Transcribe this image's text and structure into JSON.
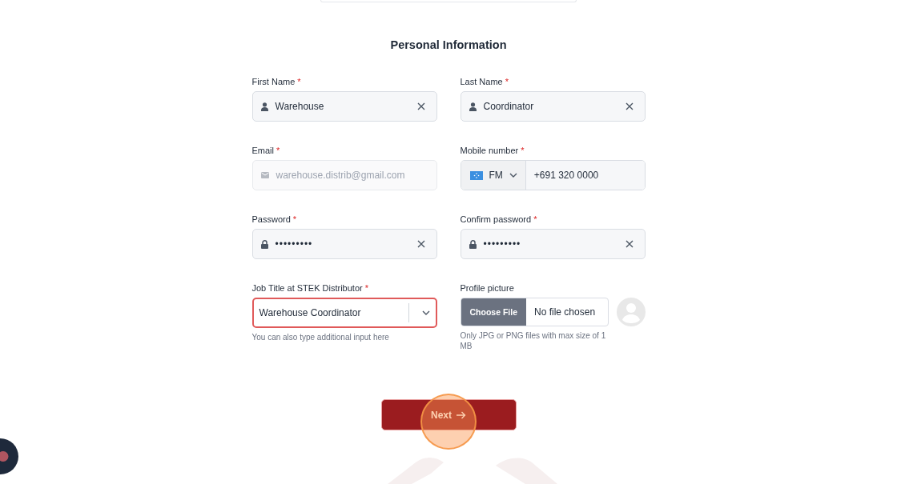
{
  "title": "Personal Information",
  "required_marker": "*",
  "fields": [
    {
      "kind": "name",
      "label": "First Name",
      "required": true,
      "value": "Warehouse"
    },
    {
      "kind": "name",
      "label": "Last Name",
      "required": true,
      "value": "Coordinator"
    },
    {
      "kind": "email",
      "label": "Email",
      "required": true,
      "value": "warehouse.distrib@gmail.com",
      "disabled": true
    },
    {
      "kind": "phone",
      "label": "Mobile number",
      "required": true,
      "country": "FM",
      "value": "+691 320 0000"
    },
    {
      "kind": "password",
      "label": "Password",
      "required": true,
      "value": "•••••••••"
    },
    {
      "kind": "password",
      "label": "Confirm password",
      "required": true,
      "value": "•••••••••"
    },
    {
      "kind": "select",
      "label": "Job Title at STEK Distributor",
      "required": true,
      "value": "Warehouse Coordinator",
      "invalid": true,
      "hint": "You can also type additional input here"
    },
    {
      "kind": "file",
      "label": "Profile picture",
      "required": false,
      "button": "Choose File",
      "status": "No file chosen",
      "hint": "Only JPG or PNG files with max size of 1 MB"
    }
  ],
  "next_button": "Next"
}
